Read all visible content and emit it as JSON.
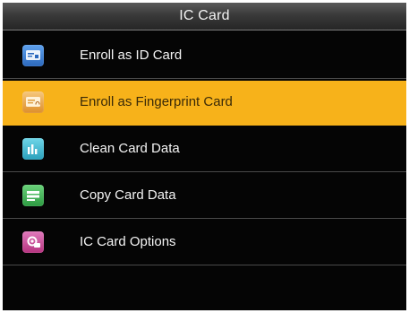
{
  "header": {
    "title": "IC Card"
  },
  "menu": {
    "items": [
      {
        "label": "Enroll as ID Card",
        "icon": "id-card-icon",
        "color": "#3a7fd0",
        "selected": false
      },
      {
        "label": "Enroll as Fingerprint Card",
        "icon": "fingerprint-card-icon",
        "color": "#e9a43f",
        "selected": true
      },
      {
        "label": "Clean Card Data",
        "icon": "clean-card-icon",
        "color": "#35b7cf",
        "selected": false
      },
      {
        "label": "Copy Card Data",
        "icon": "copy-card-icon",
        "color": "#38b24d",
        "selected": false
      },
      {
        "label": "IC Card Options",
        "icon": "card-options-icon",
        "color": "#c9469a",
        "selected": false
      }
    ]
  },
  "colors": {
    "accent": "#f7b21a",
    "background": "#050505"
  }
}
